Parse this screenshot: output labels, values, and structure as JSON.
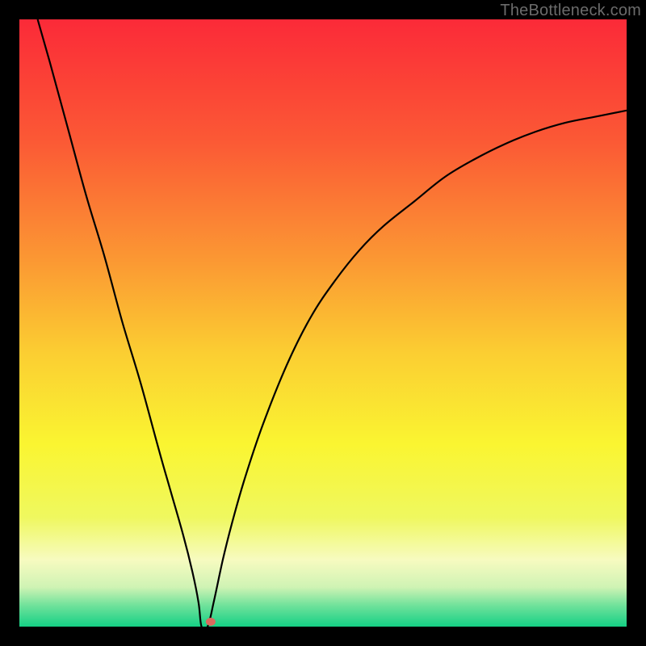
{
  "watermark": "TheBottleneck.com",
  "chart_data": {
    "type": "line",
    "title": "",
    "xlabel": "",
    "ylabel": "",
    "xlim": [
      0,
      100
    ],
    "ylim": [
      0,
      100
    ],
    "grid": false,
    "legend": false,
    "background_gradient": {
      "stops": [
        {
          "pos": 0.0,
          "color": "#fb2a38"
        },
        {
          "pos": 0.2,
          "color": "#fb5935"
        },
        {
          "pos": 0.4,
          "color": "#fb9933"
        },
        {
          "pos": 0.55,
          "color": "#fbce32"
        },
        {
          "pos": 0.7,
          "color": "#faf531"
        },
        {
          "pos": 0.82,
          "color": "#eff85f"
        },
        {
          "pos": 0.89,
          "color": "#f7fbc0"
        },
        {
          "pos": 0.935,
          "color": "#cff3b4"
        },
        {
          "pos": 0.965,
          "color": "#70e29b"
        },
        {
          "pos": 1.0,
          "color": "#15d085"
        }
      ]
    },
    "notch": {
      "x": 30.0,
      "y": 0.0
    },
    "marker": {
      "x": 31.5,
      "y": 0.8,
      "color": "#d96a5e"
    },
    "series": [
      {
        "name": "curve",
        "color": "#000000",
        "x": [
          3,
          5,
          8,
          11,
          14,
          17,
          20,
          23,
          25,
          27,
          28.5,
          29.5,
          30,
          31,
          32,
          33.5,
          35,
          37,
          40,
          44,
          48,
          52,
          56,
          60,
          65,
          70,
          75,
          80,
          85,
          90,
          95,
          100
        ],
        "y": [
          100,
          93,
          82,
          71,
          61,
          50,
          40,
          29,
          22,
          15,
          9,
          4,
          0,
          0,
          4,
          11,
          17,
          24,
          33,
          43,
          51,
          57,
          62,
          66,
          70,
          74,
          77,
          79.5,
          81.5,
          83,
          84,
          85
        ]
      }
    ]
  }
}
